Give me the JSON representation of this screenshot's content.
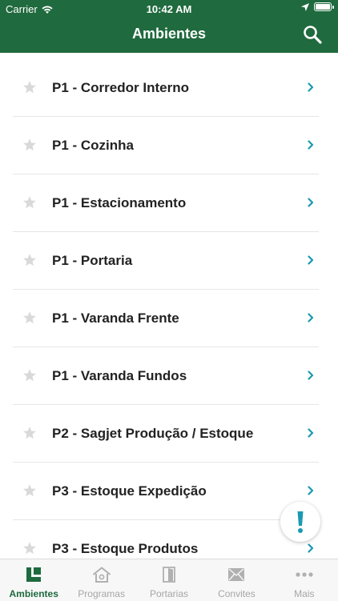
{
  "status_bar": {
    "carrier": "Carrier",
    "time": "10:42 AM"
  },
  "header": {
    "title": "Ambientes"
  },
  "list": {
    "items": [
      {
        "label": "P1 - Corredor Interno"
      },
      {
        "label": "P1 - Cozinha"
      },
      {
        "label": "P1 - Estacionamento"
      },
      {
        "label": "P1 - Portaria"
      },
      {
        "label": "P1 - Varanda Frente"
      },
      {
        "label": "P1 - Varanda Fundos"
      },
      {
        "label": "P2 - Sagjet Produção / Estoque"
      },
      {
        "label": "P3 - Estoque Expedição"
      },
      {
        "label": "P3 - Estoque Produtos"
      }
    ]
  },
  "fab": {
    "icon": "exclamation-icon",
    "symbol": "!"
  },
  "tabs": [
    {
      "label": "Ambientes",
      "icon": "ambientes-icon",
      "active": true
    },
    {
      "label": "Programas",
      "icon": "house-icon",
      "active": false
    },
    {
      "label": "Portarias",
      "icon": "door-icon",
      "active": false
    },
    {
      "label": "Convites",
      "icon": "envelope-icon",
      "active": false
    },
    {
      "label": "Mais",
      "icon": "more-dots-icon",
      "active": false
    }
  ],
  "colors": {
    "brand": "#1f6a3e",
    "accent": "#1a9ab0",
    "star": "#d9d9d9",
    "inactive": "#a6a6a6"
  }
}
